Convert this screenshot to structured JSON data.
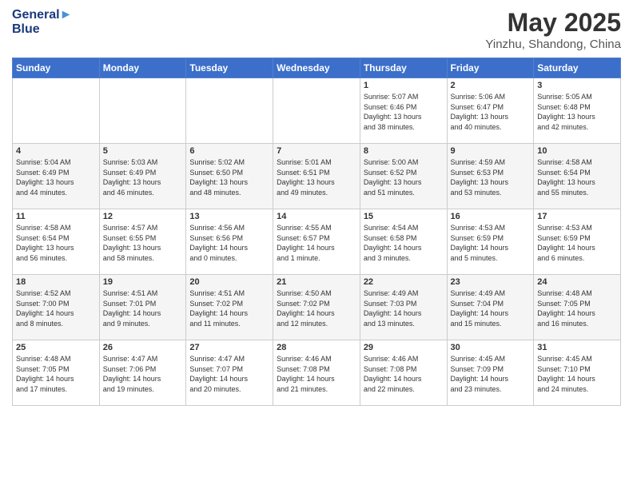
{
  "header": {
    "logo_line1": "General",
    "logo_line2": "Blue",
    "title": "May 2025",
    "subtitle": "Yinzhu, Shandong, China"
  },
  "weekdays": [
    "Sunday",
    "Monday",
    "Tuesday",
    "Wednesday",
    "Thursday",
    "Friday",
    "Saturday"
  ],
  "weeks": [
    [
      {
        "day": "",
        "info": ""
      },
      {
        "day": "",
        "info": ""
      },
      {
        "day": "",
        "info": ""
      },
      {
        "day": "",
        "info": ""
      },
      {
        "day": "1",
        "info": "Sunrise: 5:07 AM\nSunset: 6:46 PM\nDaylight: 13 hours\nand 38 minutes."
      },
      {
        "day": "2",
        "info": "Sunrise: 5:06 AM\nSunset: 6:47 PM\nDaylight: 13 hours\nand 40 minutes."
      },
      {
        "day": "3",
        "info": "Sunrise: 5:05 AM\nSunset: 6:48 PM\nDaylight: 13 hours\nand 42 minutes."
      }
    ],
    [
      {
        "day": "4",
        "info": "Sunrise: 5:04 AM\nSunset: 6:49 PM\nDaylight: 13 hours\nand 44 minutes."
      },
      {
        "day": "5",
        "info": "Sunrise: 5:03 AM\nSunset: 6:49 PM\nDaylight: 13 hours\nand 46 minutes."
      },
      {
        "day": "6",
        "info": "Sunrise: 5:02 AM\nSunset: 6:50 PM\nDaylight: 13 hours\nand 48 minutes."
      },
      {
        "day": "7",
        "info": "Sunrise: 5:01 AM\nSunset: 6:51 PM\nDaylight: 13 hours\nand 49 minutes."
      },
      {
        "day": "8",
        "info": "Sunrise: 5:00 AM\nSunset: 6:52 PM\nDaylight: 13 hours\nand 51 minutes."
      },
      {
        "day": "9",
        "info": "Sunrise: 4:59 AM\nSunset: 6:53 PM\nDaylight: 13 hours\nand 53 minutes."
      },
      {
        "day": "10",
        "info": "Sunrise: 4:58 AM\nSunset: 6:54 PM\nDaylight: 13 hours\nand 55 minutes."
      }
    ],
    [
      {
        "day": "11",
        "info": "Sunrise: 4:58 AM\nSunset: 6:54 PM\nDaylight: 13 hours\nand 56 minutes."
      },
      {
        "day": "12",
        "info": "Sunrise: 4:57 AM\nSunset: 6:55 PM\nDaylight: 13 hours\nand 58 minutes."
      },
      {
        "day": "13",
        "info": "Sunrise: 4:56 AM\nSunset: 6:56 PM\nDaylight: 14 hours\nand 0 minutes."
      },
      {
        "day": "14",
        "info": "Sunrise: 4:55 AM\nSunset: 6:57 PM\nDaylight: 14 hours\nand 1 minute."
      },
      {
        "day": "15",
        "info": "Sunrise: 4:54 AM\nSunset: 6:58 PM\nDaylight: 14 hours\nand 3 minutes."
      },
      {
        "day": "16",
        "info": "Sunrise: 4:53 AM\nSunset: 6:59 PM\nDaylight: 14 hours\nand 5 minutes."
      },
      {
        "day": "17",
        "info": "Sunrise: 4:53 AM\nSunset: 6:59 PM\nDaylight: 14 hours\nand 6 minutes."
      }
    ],
    [
      {
        "day": "18",
        "info": "Sunrise: 4:52 AM\nSunset: 7:00 PM\nDaylight: 14 hours\nand 8 minutes."
      },
      {
        "day": "19",
        "info": "Sunrise: 4:51 AM\nSunset: 7:01 PM\nDaylight: 14 hours\nand 9 minutes."
      },
      {
        "day": "20",
        "info": "Sunrise: 4:51 AM\nSunset: 7:02 PM\nDaylight: 14 hours\nand 11 minutes."
      },
      {
        "day": "21",
        "info": "Sunrise: 4:50 AM\nSunset: 7:02 PM\nDaylight: 14 hours\nand 12 minutes."
      },
      {
        "day": "22",
        "info": "Sunrise: 4:49 AM\nSunset: 7:03 PM\nDaylight: 14 hours\nand 13 minutes."
      },
      {
        "day": "23",
        "info": "Sunrise: 4:49 AM\nSunset: 7:04 PM\nDaylight: 14 hours\nand 15 minutes."
      },
      {
        "day": "24",
        "info": "Sunrise: 4:48 AM\nSunset: 7:05 PM\nDaylight: 14 hours\nand 16 minutes."
      }
    ],
    [
      {
        "day": "25",
        "info": "Sunrise: 4:48 AM\nSunset: 7:05 PM\nDaylight: 14 hours\nand 17 minutes."
      },
      {
        "day": "26",
        "info": "Sunrise: 4:47 AM\nSunset: 7:06 PM\nDaylight: 14 hours\nand 19 minutes."
      },
      {
        "day": "27",
        "info": "Sunrise: 4:47 AM\nSunset: 7:07 PM\nDaylight: 14 hours\nand 20 minutes."
      },
      {
        "day": "28",
        "info": "Sunrise: 4:46 AM\nSunset: 7:08 PM\nDaylight: 14 hours\nand 21 minutes."
      },
      {
        "day": "29",
        "info": "Sunrise: 4:46 AM\nSunset: 7:08 PM\nDaylight: 14 hours\nand 22 minutes."
      },
      {
        "day": "30",
        "info": "Sunrise: 4:45 AM\nSunset: 7:09 PM\nDaylight: 14 hours\nand 23 minutes."
      },
      {
        "day": "31",
        "info": "Sunrise: 4:45 AM\nSunset: 7:10 PM\nDaylight: 14 hours\nand 24 minutes."
      }
    ]
  ]
}
